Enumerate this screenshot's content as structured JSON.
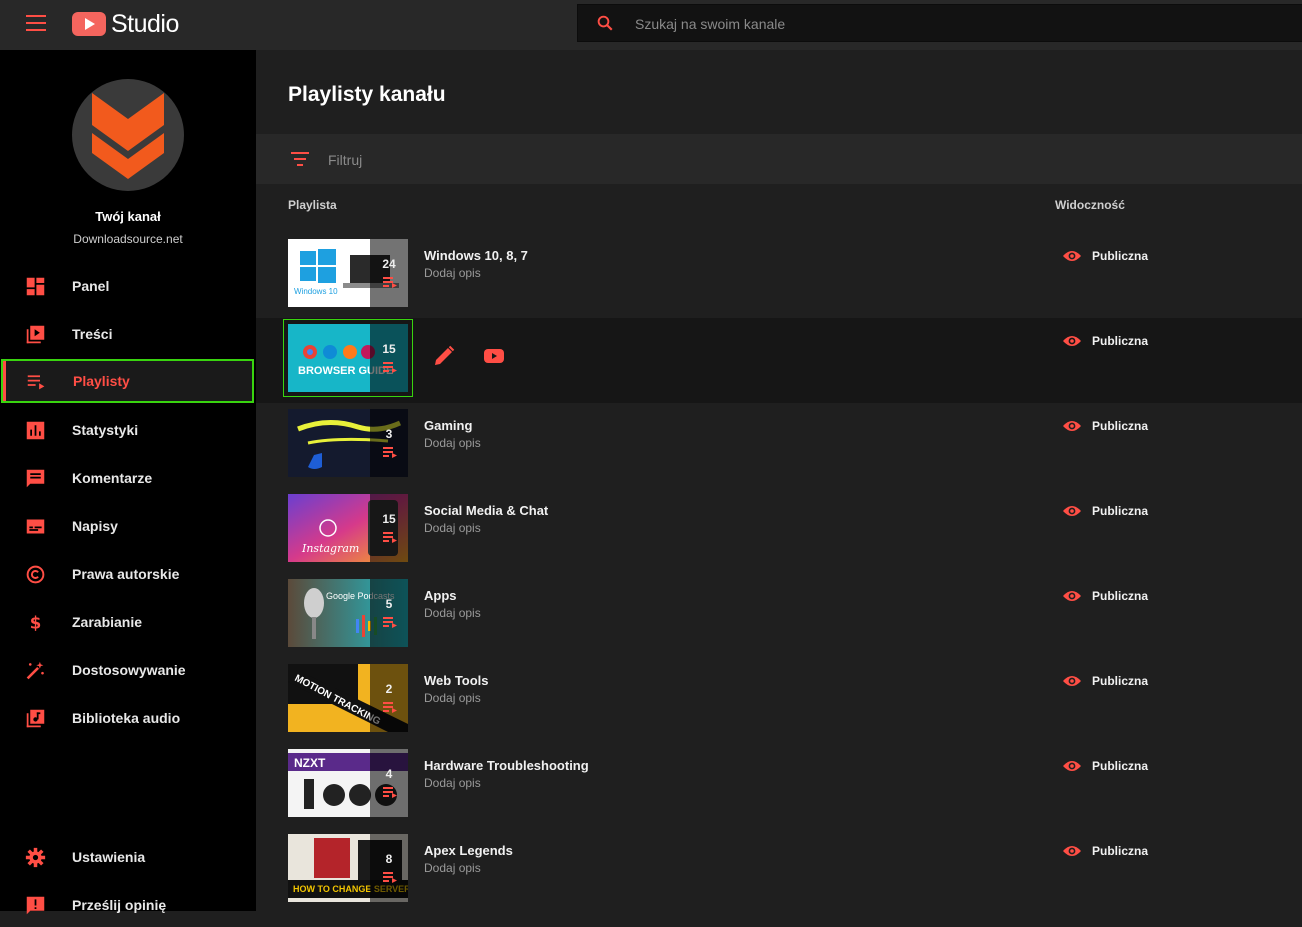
{
  "header": {
    "logo_text": "Studio",
    "search_placeholder": "Szukaj na swoim kanale"
  },
  "channel": {
    "title": "Twój kanał",
    "name": "Downloadsource.net"
  },
  "sidebar": {
    "items": [
      {
        "label": "Panel",
        "icon": "dashboard-icon"
      },
      {
        "label": "Treści",
        "icon": "content-icon"
      },
      {
        "label": "Playlisty",
        "icon": "playlist-icon",
        "active": true
      },
      {
        "label": "Statystyki",
        "icon": "analytics-icon"
      },
      {
        "label": "Komentarze",
        "icon": "comments-icon"
      },
      {
        "label": "Napisy",
        "icon": "subtitles-icon"
      },
      {
        "label": "Prawa autorskie",
        "icon": "copyright-icon"
      },
      {
        "label": "Zarabianie",
        "icon": "dollar-icon"
      },
      {
        "label": "Dostosowywanie",
        "icon": "customization-icon"
      },
      {
        "label": "Biblioteka audio",
        "icon": "audio-library-icon"
      }
    ],
    "bottom_items": [
      {
        "label": "Ustawienia",
        "icon": "gear-icon"
      },
      {
        "label": "Prześlij opinię",
        "icon": "feedback-icon"
      }
    ]
  },
  "main": {
    "title": "Playlisty kanału",
    "filter_placeholder": "Filtruj",
    "columns": {
      "playlist": "Playlista",
      "visibility": "Widoczność"
    },
    "rows": [
      {
        "title": "Windows 10, 8, 7",
        "desc": "Dodaj opis",
        "count": "24",
        "visibility": "Publiczna",
        "thumb_text": "Windows 10"
      },
      {
        "title": "",
        "desc": "",
        "count": "15",
        "visibility": "Publiczna",
        "thumb_text": "BROWSER GUIDE"
      },
      {
        "title": "Gaming",
        "desc": "Dodaj opis",
        "count": "3",
        "visibility": "Publiczna",
        "thumb_text": ""
      },
      {
        "title": "Social Media & Chat",
        "desc": "Dodaj opis",
        "count": "15",
        "visibility": "Publiczna",
        "thumb_text": "Instagram"
      },
      {
        "title": "Apps",
        "desc": "Dodaj opis",
        "count": "5",
        "visibility": "Publiczna",
        "thumb_text": "Google Podcasts"
      },
      {
        "title": "Web Tools",
        "desc": "Dodaj opis",
        "count": "2",
        "visibility": "Publiczna",
        "thumb_text": "MOTION TRACKING"
      },
      {
        "title": "Hardware Troubleshooting",
        "desc": "Dodaj opis",
        "count": "4",
        "visibility": "Publiczna",
        "thumb_text": "NZXT"
      },
      {
        "title": "Apex Legends",
        "desc": "Dodaj opis",
        "count": "8",
        "visibility": "Publiczna",
        "thumb_text": "HOW TO CHANGE SERVERS"
      }
    ]
  },
  "colors": {
    "accent": "#ff4e45",
    "highlight": "#39d40f"
  }
}
